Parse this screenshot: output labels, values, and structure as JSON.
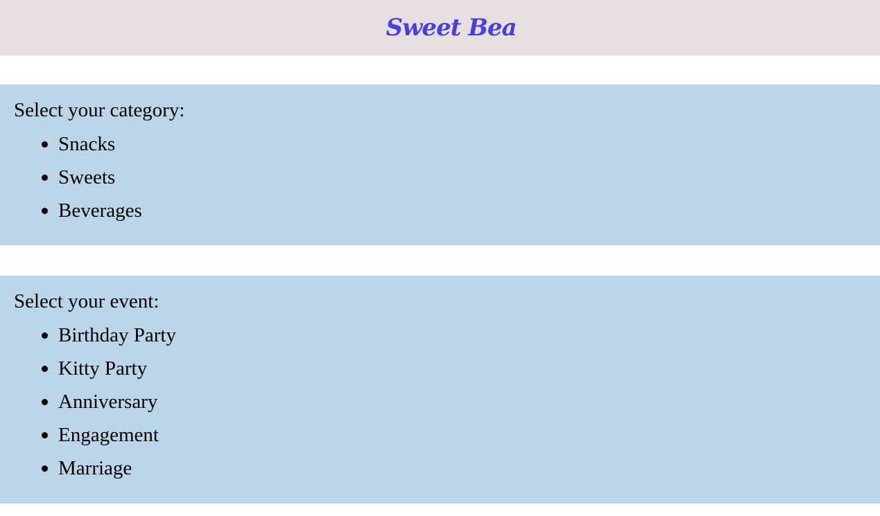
{
  "header": {
    "title": "Sweet Bea",
    "background": "#e7dfdf",
    "title_color": "#4a3fd8"
  },
  "panel_color": "#bcd6e9",
  "category": {
    "heading": "Select your category:",
    "items": [
      "Snacks",
      "Sweets",
      "Beverages"
    ]
  },
  "event": {
    "heading": "Select your event:",
    "items": [
      "Birthday Party",
      "Kitty Party",
      "Anniversary",
      "Engagement",
      "Marriage"
    ]
  }
}
